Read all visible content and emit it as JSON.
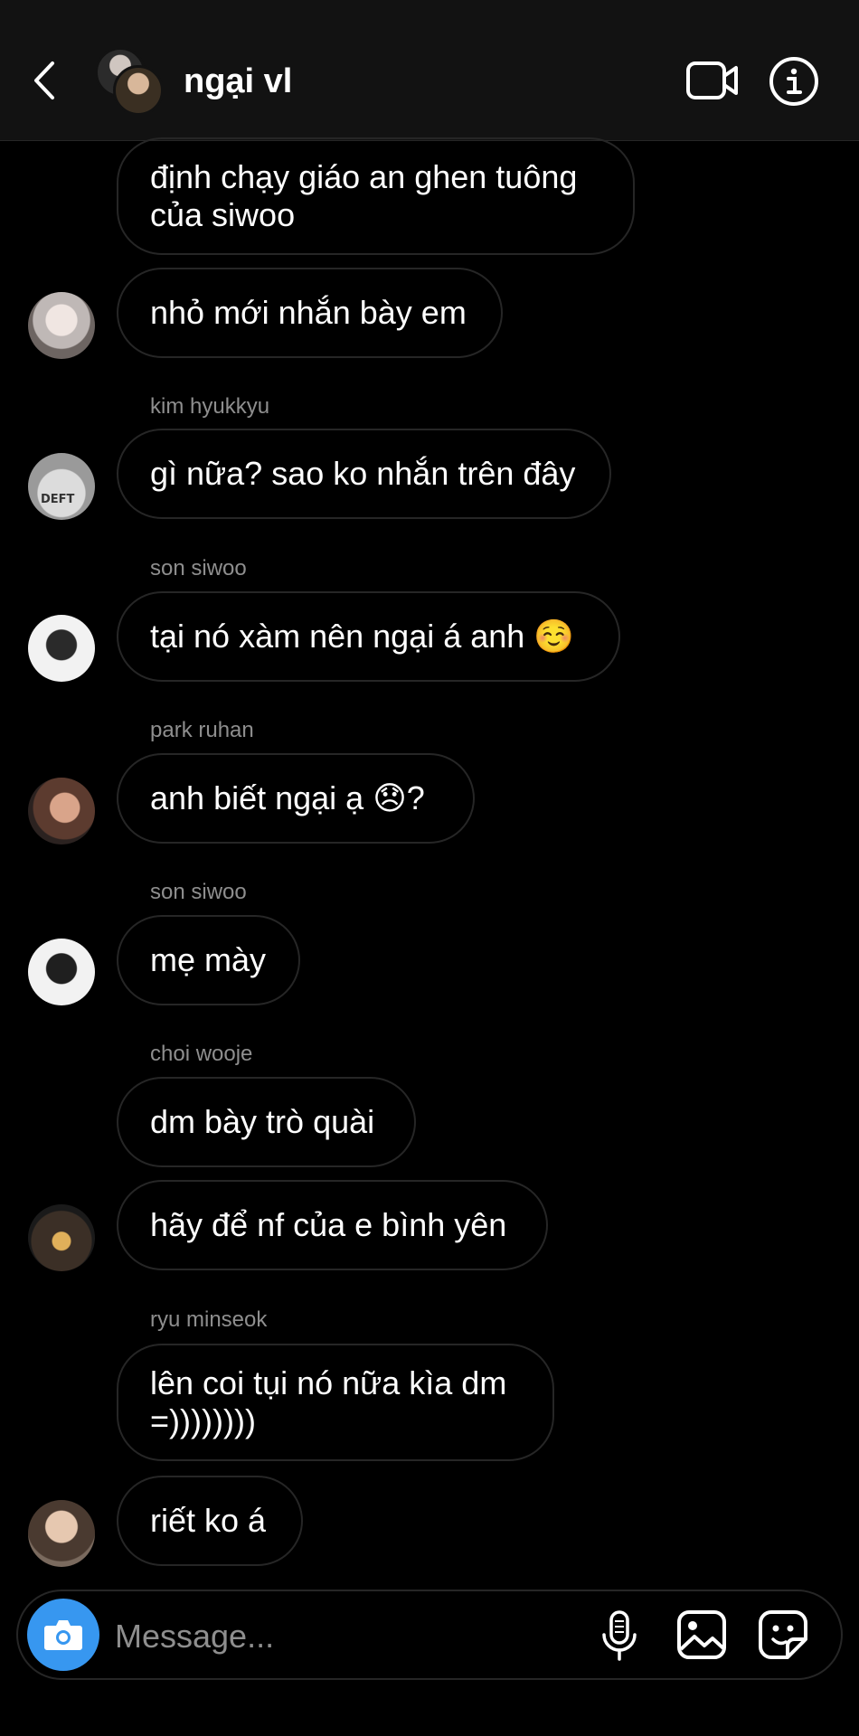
{
  "header": {
    "title": "ngại vl"
  },
  "messages": [
    {
      "text": "định chạy giáo an ghen tuông\ncủa siwoo"
    },
    {
      "text": "nhỏ mới nhắn bày em"
    },
    {
      "sender": "kim hyukkyu",
      "text": "gì nữa? sao ko nhắn trên đây",
      "avatar_text": "DEFT"
    },
    {
      "sender": "son siwoo",
      "text": "tại nó xàm nên ngại á anh ☺️"
    },
    {
      "sender": "park ruhan",
      "text": "anh biết ngại ạ 😞?"
    },
    {
      "sender": "son siwoo",
      "text": "mẹ mày"
    },
    {
      "sender": "choi wooje",
      "text": "dm bày trò quài"
    },
    {
      "text": "hãy để nf của e bình yên"
    },
    {
      "sender": "ryu minseok",
      "text": "lên coi tụi nó nữa kìa dm\n=))))))))"
    },
    {
      "text": "riết ko á"
    }
  ],
  "composer": {
    "placeholder": "Message..."
  },
  "icons": {
    "back": "chevron-left-icon",
    "video": "video-camera-icon",
    "info": "info-icon",
    "camera": "camera-icon",
    "mic": "microphone-icon",
    "gallery": "image-icon",
    "sticker": "sticker-icon"
  },
  "colors": {
    "background": "#000000",
    "header": "#121212",
    "bubble_border": "#262626",
    "sender_text": "#8e8e8e",
    "camera_button": "#3797f0"
  }
}
